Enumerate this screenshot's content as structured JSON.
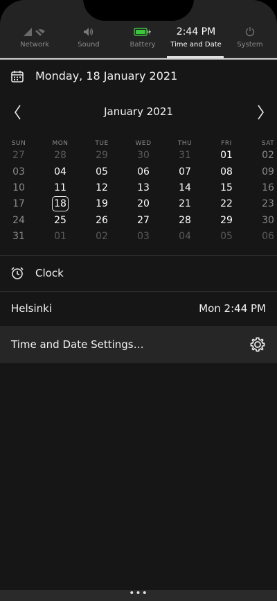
{
  "tabs": [
    {
      "label": "Network",
      "icon": "network-icon"
    },
    {
      "label": "Sound",
      "icon": "sound-icon"
    },
    {
      "label": "Battery",
      "icon": "battery-icon"
    },
    {
      "label": "Time and Date",
      "time": "2:44 PM"
    },
    {
      "label": "System",
      "icon": "power-icon"
    }
  ],
  "header": {
    "date": "Monday, 18 January 2021"
  },
  "calendar": {
    "month_title": "January 2021",
    "weekdays": [
      "SUN",
      "MON",
      "TUE",
      "WED",
      "THU",
      "FRI",
      "SAT"
    ],
    "weeks": [
      [
        "27",
        "28",
        "29",
        "30",
        "31",
        "01",
        "02"
      ],
      [
        "03",
        "04",
        "05",
        "06",
        "07",
        "08",
        "09"
      ],
      [
        "10",
        "11",
        "12",
        "13",
        "14",
        "15",
        "16"
      ],
      [
        "17",
        "18",
        "19",
        "20",
        "21",
        "22",
        "23"
      ],
      [
        "24",
        "25",
        "26",
        "27",
        "28",
        "29",
        "30"
      ],
      [
        "31",
        "01",
        "02",
        "03",
        "04",
        "05",
        "06"
      ]
    ],
    "today": "18"
  },
  "clock": {
    "label": "Clock"
  },
  "city": {
    "name": "Helsinki",
    "time": "Mon 2:44 PM"
  },
  "settings": {
    "label": "Time and Date Settings…"
  },
  "colors": {
    "battery": "#3cc43c",
    "background": "#161616"
  }
}
